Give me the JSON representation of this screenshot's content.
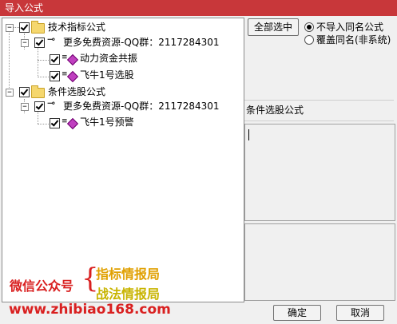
{
  "window": {
    "title": "导入公式"
  },
  "tree": {
    "groups": [
      {
        "label": "技术指标公式",
        "subgroup": "更多免费资源-QQ群：2117284301",
        "items": [
          "动力资金共振",
          "飞牛1号选股"
        ]
      },
      {
        "label": "条件选股公式",
        "subgroup": "更多免费资源-QQ群：2117284301",
        "items": [
          "飞牛1号预警"
        ]
      }
    ]
  },
  "buttons": {
    "select_all": "全部选中",
    "ok": "确定",
    "cancel": "取消"
  },
  "options": [
    {
      "label": "不导入同名公式",
      "selected": true
    },
    {
      "label": "覆盖同名(非系统)",
      "selected": false
    }
  ],
  "detail": {
    "type_label": "条件选股公式"
  },
  "overlay": {
    "wechat": "微信公众号",
    "line1": "指标情报局",
    "line2": "战法情报局",
    "url": "www.zhibiao168.com"
  },
  "colors": {
    "titlebar": "#c8373a",
    "overlay_red": "#d92020",
    "overlay_gold": "#e0a000"
  }
}
